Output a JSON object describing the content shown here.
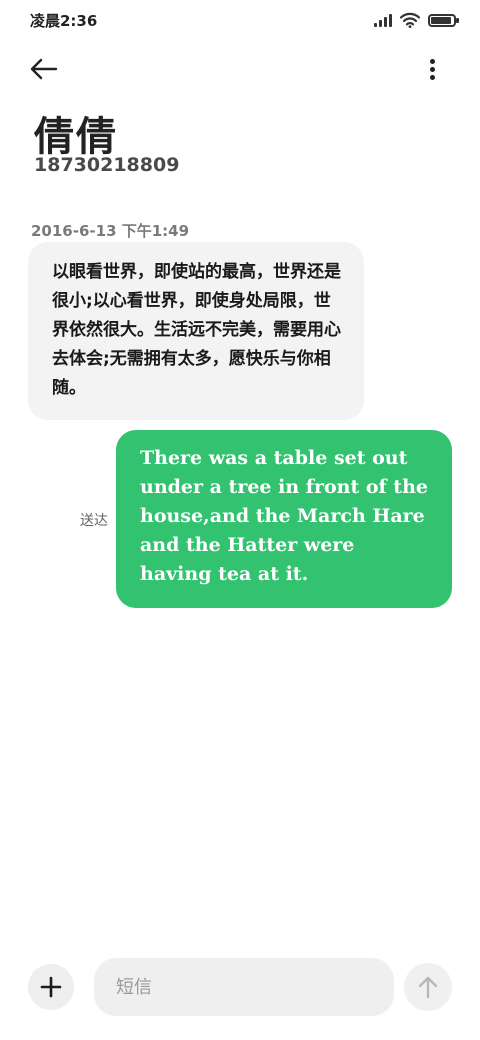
{
  "status_bar": {
    "time": "凌晨2:36",
    "icons": [
      "signal-icon",
      "wifi-icon",
      "battery-icon"
    ],
    "battery_level": 0.9
  },
  "header": {
    "back_icon": "arrow-left-icon",
    "more_icon": "more-vertical-icon",
    "contact_name": "倩倩",
    "contact_number": "18730218809"
  },
  "conversation": {
    "timestamp": "2016-6-13 下午1:49",
    "incoming_message": "以眼看世界，即使站的最高，世界还是很小;以心看世界，即使身处局限，世界依然很大。生活远不完美，需要用心去体会;无需拥有太多，愿快乐与你相随。",
    "outgoing_message": "There was a table set out under a tree in front of the house,and the March Hare and the Hatter were having tea at it.",
    "delivery_status": "送达"
  },
  "composer": {
    "input_value": "",
    "input_placeholder": "短信",
    "add_icon": "plus-icon",
    "send_icon": "arrow-up-icon"
  },
  "colors": {
    "outgoing_bubble": "#33c270",
    "incoming_bubble": "#f3f3f3",
    "input_background": "#efefef"
  }
}
